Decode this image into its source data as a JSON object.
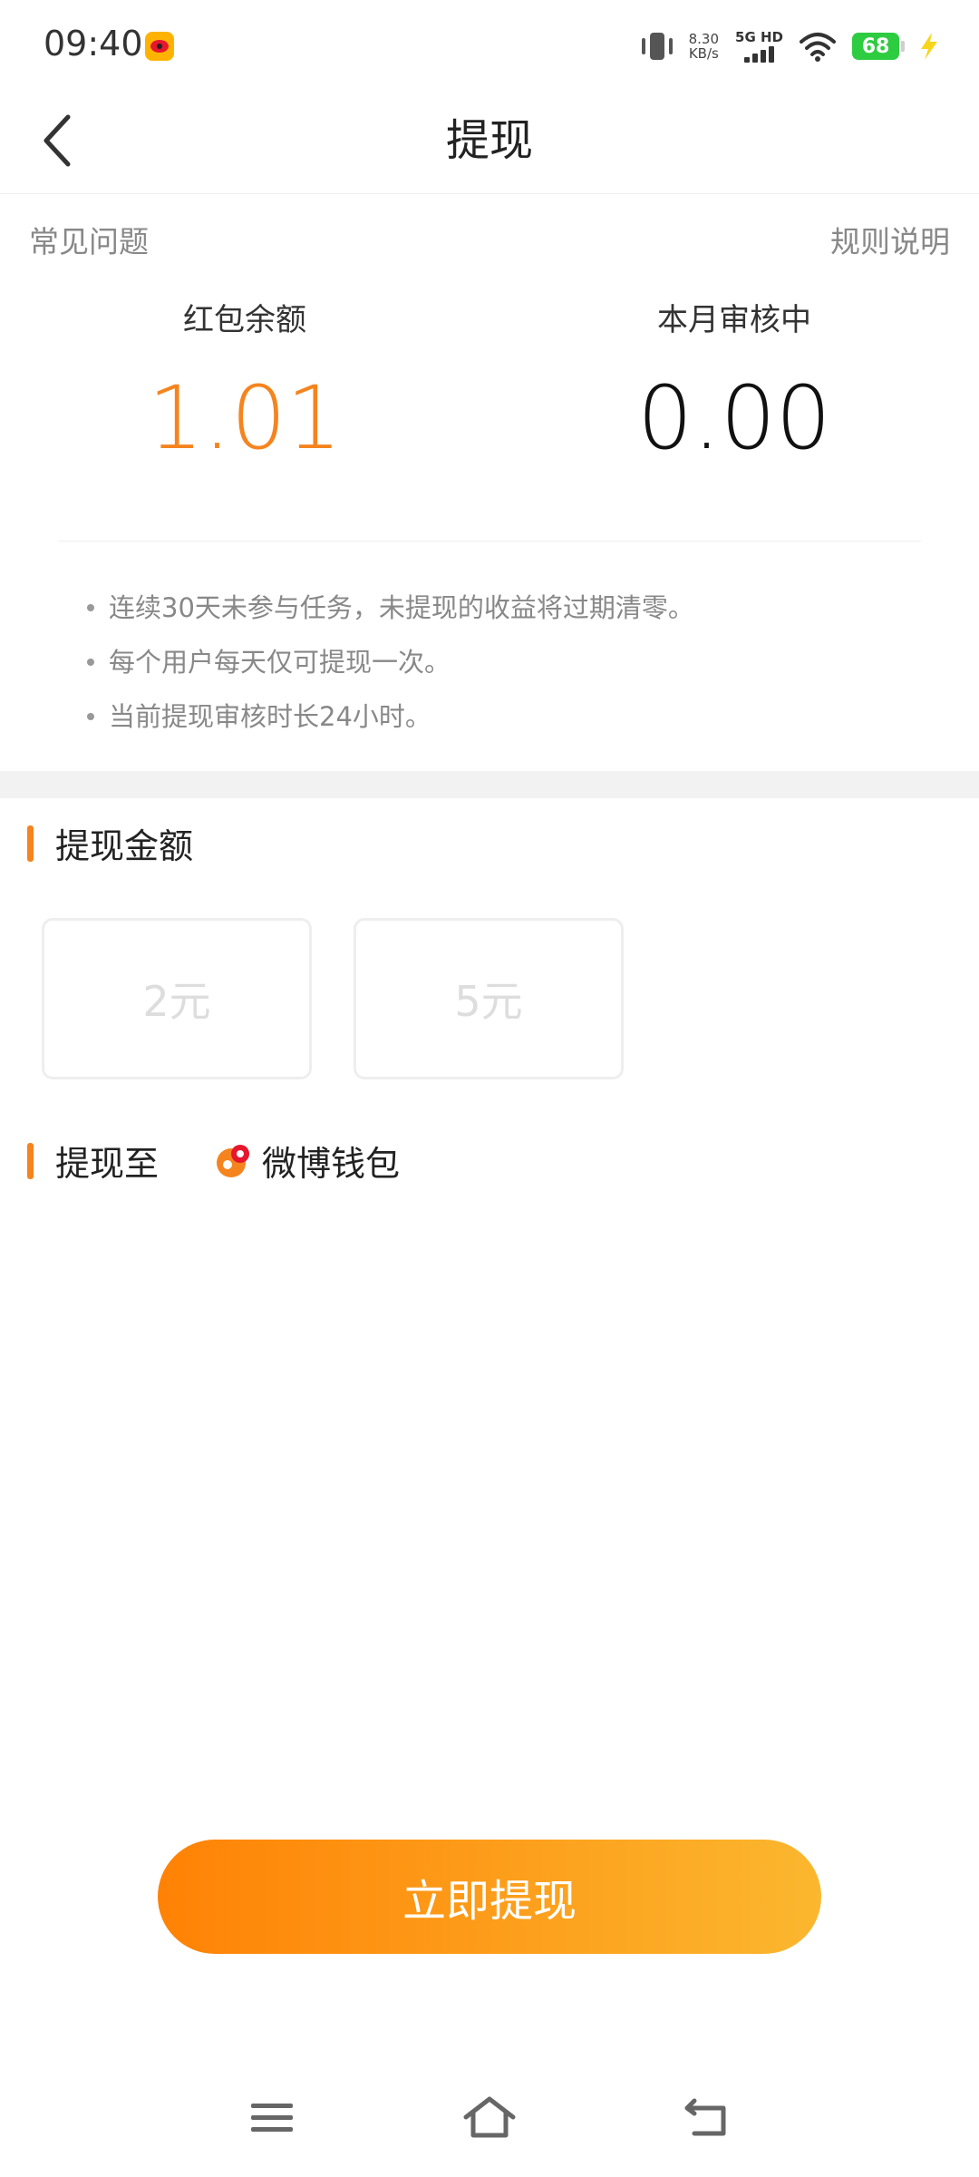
{
  "status_bar": {
    "time": "09:40",
    "net_speed_value": "8.30",
    "net_speed_unit": "KB/s",
    "network_label": "5G HD",
    "battery_level": "68",
    "icons": [
      "weibo-notification-icon",
      "vibrate-icon",
      "signal-icon",
      "wifi-icon",
      "battery-icon",
      "charging-icon"
    ]
  },
  "nav": {
    "title": "提现"
  },
  "links": {
    "faq": "常见问题",
    "rules": "规则说明"
  },
  "balances": {
    "red_packet_label": "红包余额",
    "red_packet_value": "1.01",
    "review_label": "本月审核中",
    "review_value": "0.00"
  },
  "notes": [
    "连续30天未参与任务，未提现的收益将过期清零。",
    "每个用户每天仅可提现一次。",
    "当前提现审核时长24小时。"
  ],
  "withdraw_amount": {
    "title": "提现金额",
    "options": [
      "2元",
      "5元"
    ]
  },
  "withdraw_to": {
    "title": "提现至",
    "wallet_name": "微博钱包"
  },
  "submit": {
    "label": "立即提现"
  },
  "colors": {
    "accent": "#f5841f",
    "button_gradient_start": "#ff8205",
    "button_gradient_end": "#fbb72f"
  }
}
